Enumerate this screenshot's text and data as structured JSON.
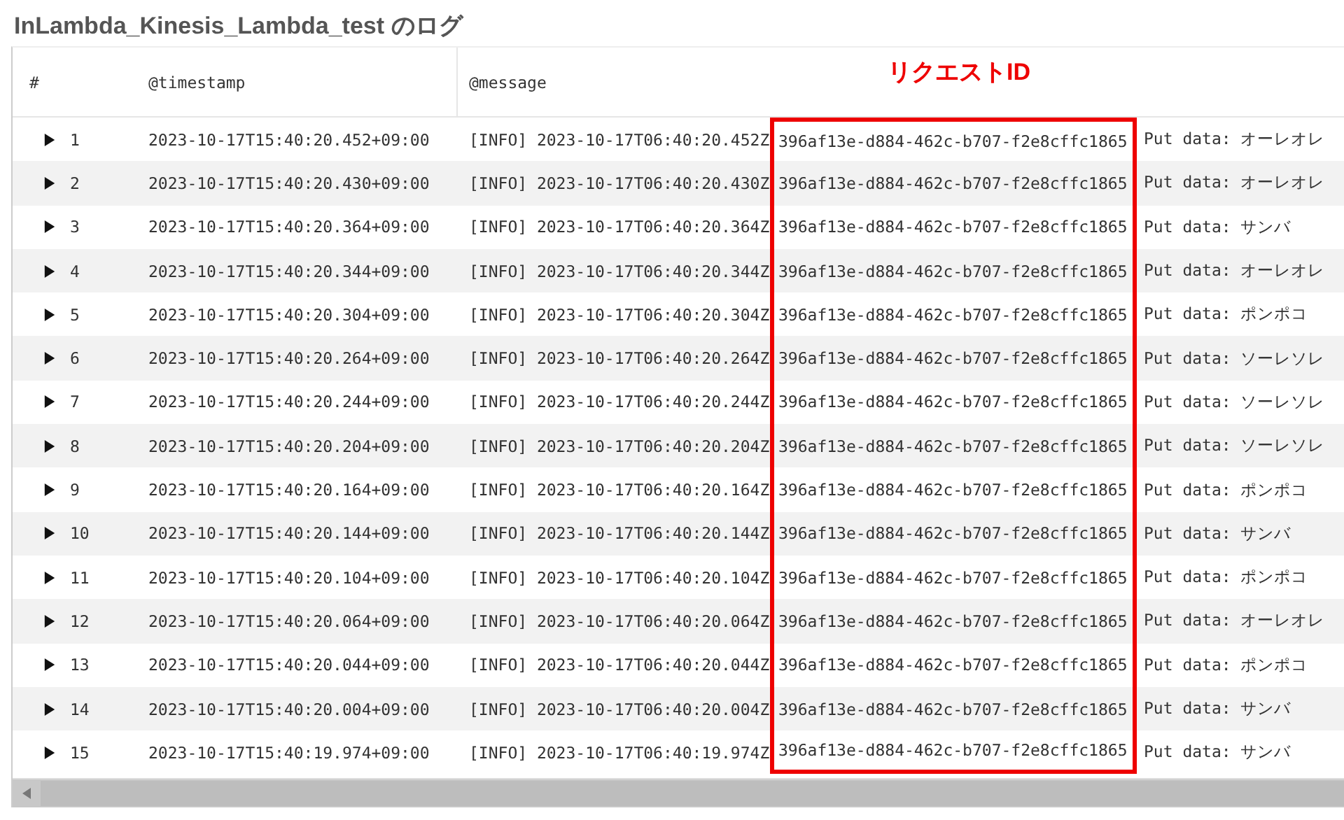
{
  "title": "InLambda_Kinesis_Lambda_test のログ",
  "columns": [
    "#",
    "@timestamp",
    "@message"
  ],
  "highlight_label": "リクエストID",
  "rows": [
    {
      "expanded": false,
      "num": "1",
      "timestamp": "2023-10-17T15:40:20.452+09:00",
      "prefix": "[INFO] 2023-10-17T06:40:20.452Z",
      "request_id": "396af13e-d884-462c-b707-f2e8cffc1865",
      "data": "Put data: オーレオレ"
    },
    {
      "expanded": false,
      "num": "2",
      "timestamp": "2023-10-17T15:40:20.430+09:00",
      "prefix": "[INFO] 2023-10-17T06:40:20.430Z",
      "request_id": "396af13e-d884-462c-b707-f2e8cffc1865",
      "data": "Put data: オーレオレ"
    },
    {
      "expanded": false,
      "num": "3",
      "timestamp": "2023-10-17T15:40:20.364+09:00",
      "prefix": "[INFO] 2023-10-17T06:40:20.364Z",
      "request_id": "396af13e-d884-462c-b707-f2e8cffc1865",
      "data": "Put data: サンバ"
    },
    {
      "expanded": false,
      "num": "4",
      "timestamp": "2023-10-17T15:40:20.344+09:00",
      "prefix": "[INFO] 2023-10-17T06:40:20.344Z",
      "request_id": "396af13e-d884-462c-b707-f2e8cffc1865",
      "data": "Put data: オーレオレ"
    },
    {
      "expanded": false,
      "num": "5",
      "timestamp": "2023-10-17T15:40:20.304+09:00",
      "prefix": "[INFO] 2023-10-17T06:40:20.304Z",
      "request_id": "396af13e-d884-462c-b707-f2e8cffc1865",
      "data": "Put data: ポンポコ"
    },
    {
      "expanded": false,
      "num": "6",
      "timestamp": "2023-10-17T15:40:20.264+09:00",
      "prefix": "[INFO] 2023-10-17T06:40:20.264Z",
      "request_id": "396af13e-d884-462c-b707-f2e8cffc1865",
      "data": "Put data: ソーレソレ"
    },
    {
      "expanded": false,
      "num": "7",
      "timestamp": "2023-10-17T15:40:20.244+09:00",
      "prefix": "[INFO] 2023-10-17T06:40:20.244Z",
      "request_id": "396af13e-d884-462c-b707-f2e8cffc1865",
      "data": "Put data: ソーレソレ"
    },
    {
      "expanded": false,
      "num": "8",
      "timestamp": "2023-10-17T15:40:20.204+09:00",
      "prefix": "[INFO] 2023-10-17T06:40:20.204Z",
      "request_id": "396af13e-d884-462c-b707-f2e8cffc1865",
      "data": "Put data: ソーレソレ"
    },
    {
      "expanded": false,
      "num": "9",
      "timestamp": "2023-10-17T15:40:20.164+09:00",
      "prefix": "[INFO] 2023-10-17T06:40:20.164Z",
      "request_id": "396af13e-d884-462c-b707-f2e8cffc1865",
      "data": "Put data: ポンポコ"
    },
    {
      "expanded": false,
      "num": "10",
      "timestamp": "2023-10-17T15:40:20.144+09:00",
      "prefix": "[INFO] 2023-10-17T06:40:20.144Z",
      "request_id": "396af13e-d884-462c-b707-f2e8cffc1865",
      "data": "Put data: サンバ"
    },
    {
      "expanded": false,
      "num": "11",
      "timestamp": "2023-10-17T15:40:20.104+09:00",
      "prefix": "[INFO] 2023-10-17T06:40:20.104Z",
      "request_id": "396af13e-d884-462c-b707-f2e8cffc1865",
      "data": "Put data: ポンポコ"
    },
    {
      "expanded": false,
      "num": "12",
      "timestamp": "2023-10-17T15:40:20.064+09:00",
      "prefix": "[INFO] 2023-10-17T06:40:20.064Z",
      "request_id": "396af13e-d884-462c-b707-f2e8cffc1865",
      "data": "Put data: オーレオレ"
    },
    {
      "expanded": false,
      "num": "13",
      "timestamp": "2023-10-17T15:40:20.044+09:00",
      "prefix": "[INFO] 2023-10-17T06:40:20.044Z",
      "request_id": "396af13e-d884-462c-b707-f2e8cffc1865",
      "data": "Put data: ポンポコ"
    },
    {
      "expanded": false,
      "num": "14",
      "timestamp": "2023-10-17T15:40:20.004+09:00",
      "prefix": "[INFO] 2023-10-17T06:40:20.004Z",
      "request_id": "396af13e-d884-462c-b707-f2e8cffc1865",
      "data": "Put data: サンバ"
    },
    {
      "expanded": false,
      "num": "15",
      "timestamp": "2023-10-17T15:40:19.974+09:00",
      "prefix": "[INFO] 2023-10-17T06:40:19.974Z",
      "request_id": "396af13e-d884-462c-b707-f2e8cffc1865",
      "data": "Put data: サンバ"
    }
  ]
}
